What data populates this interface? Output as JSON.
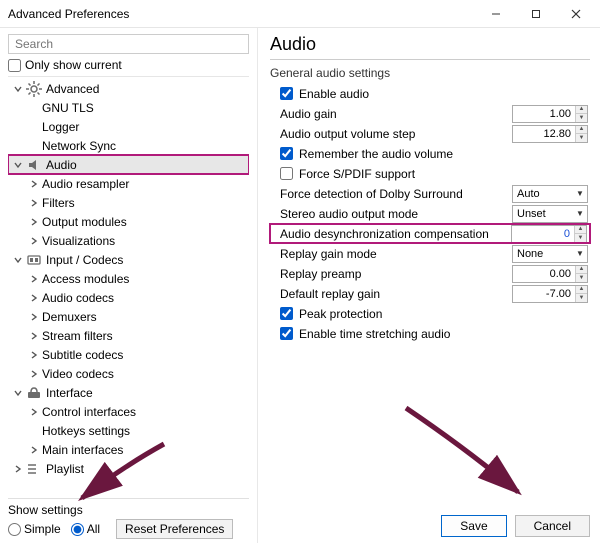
{
  "window": {
    "title": "Advanced Preferences"
  },
  "left": {
    "search_placeholder": "Search",
    "only_show_current": "Only show current",
    "show_settings_label": "Show settings",
    "radio_simple": "Simple",
    "radio_all": "All",
    "reset_label": "Reset Preferences",
    "tree": [
      {
        "label": "Advanced",
        "depth": 0,
        "expanded": true,
        "icon": "gear"
      },
      {
        "label": "GNU TLS",
        "depth": 1,
        "expanded": null
      },
      {
        "label": "Logger",
        "depth": 1,
        "expanded": null
      },
      {
        "label": "Network Sync",
        "depth": 1,
        "expanded": null
      },
      {
        "label": "Audio",
        "depth": 0,
        "expanded": true,
        "icon": "audio",
        "selected": true,
        "highlight": true
      },
      {
        "label": "Audio resampler",
        "depth": 1,
        "expanded": false
      },
      {
        "label": "Filters",
        "depth": 1,
        "expanded": false
      },
      {
        "label": "Output modules",
        "depth": 1,
        "expanded": false
      },
      {
        "label": "Visualizations",
        "depth": 1,
        "expanded": false
      },
      {
        "label": "Input / Codecs",
        "depth": 0,
        "expanded": true,
        "icon": "codec"
      },
      {
        "label": "Access modules",
        "depth": 1,
        "expanded": false
      },
      {
        "label": "Audio codecs",
        "depth": 1,
        "expanded": false
      },
      {
        "label": "Demuxers",
        "depth": 1,
        "expanded": false
      },
      {
        "label": "Stream filters",
        "depth": 1,
        "expanded": false
      },
      {
        "label": "Subtitle codecs",
        "depth": 1,
        "expanded": false
      },
      {
        "label": "Video codecs",
        "depth": 1,
        "expanded": false
      },
      {
        "label": "Interface",
        "depth": 0,
        "expanded": true,
        "icon": "iface"
      },
      {
        "label": "Control interfaces",
        "depth": 1,
        "expanded": false
      },
      {
        "label": "Hotkeys settings",
        "depth": 1,
        "expanded": null
      },
      {
        "label": "Main interfaces",
        "depth": 1,
        "expanded": false
      },
      {
        "label": "Playlist",
        "depth": 0,
        "expanded": false,
        "icon": "play"
      }
    ]
  },
  "right": {
    "title": "Audio",
    "section": "General audio settings",
    "settings": [
      {
        "type": "check",
        "label": "Enable audio",
        "checked": true
      },
      {
        "type": "spin",
        "label": "Audio gain",
        "value": "1.00"
      },
      {
        "type": "spin",
        "label": "Audio output volume step",
        "value": "12.80"
      },
      {
        "type": "check",
        "label": "Remember the audio volume",
        "checked": true
      },
      {
        "type": "check",
        "label": "Force S/PDIF support",
        "checked": false
      },
      {
        "type": "combo",
        "label": "Force detection of Dolby Surround",
        "value": "Auto"
      },
      {
        "type": "combo",
        "label": "Stereo audio output mode",
        "value": "Unset"
      },
      {
        "type": "spin",
        "label": "Audio desynchronization compensation",
        "value": "0",
        "highlight": true
      },
      {
        "type": "combo",
        "label": "Replay gain mode",
        "value": "None"
      },
      {
        "type": "spin",
        "label": "Replay preamp",
        "value": "0.00"
      },
      {
        "type": "spin",
        "label": "Default replay gain",
        "value": "-7.00"
      },
      {
        "type": "check",
        "label": "Peak protection",
        "checked": true
      },
      {
        "type": "check",
        "label": "Enable time stretching audio",
        "checked": true
      }
    ],
    "save": "Save",
    "cancel": "Cancel"
  }
}
